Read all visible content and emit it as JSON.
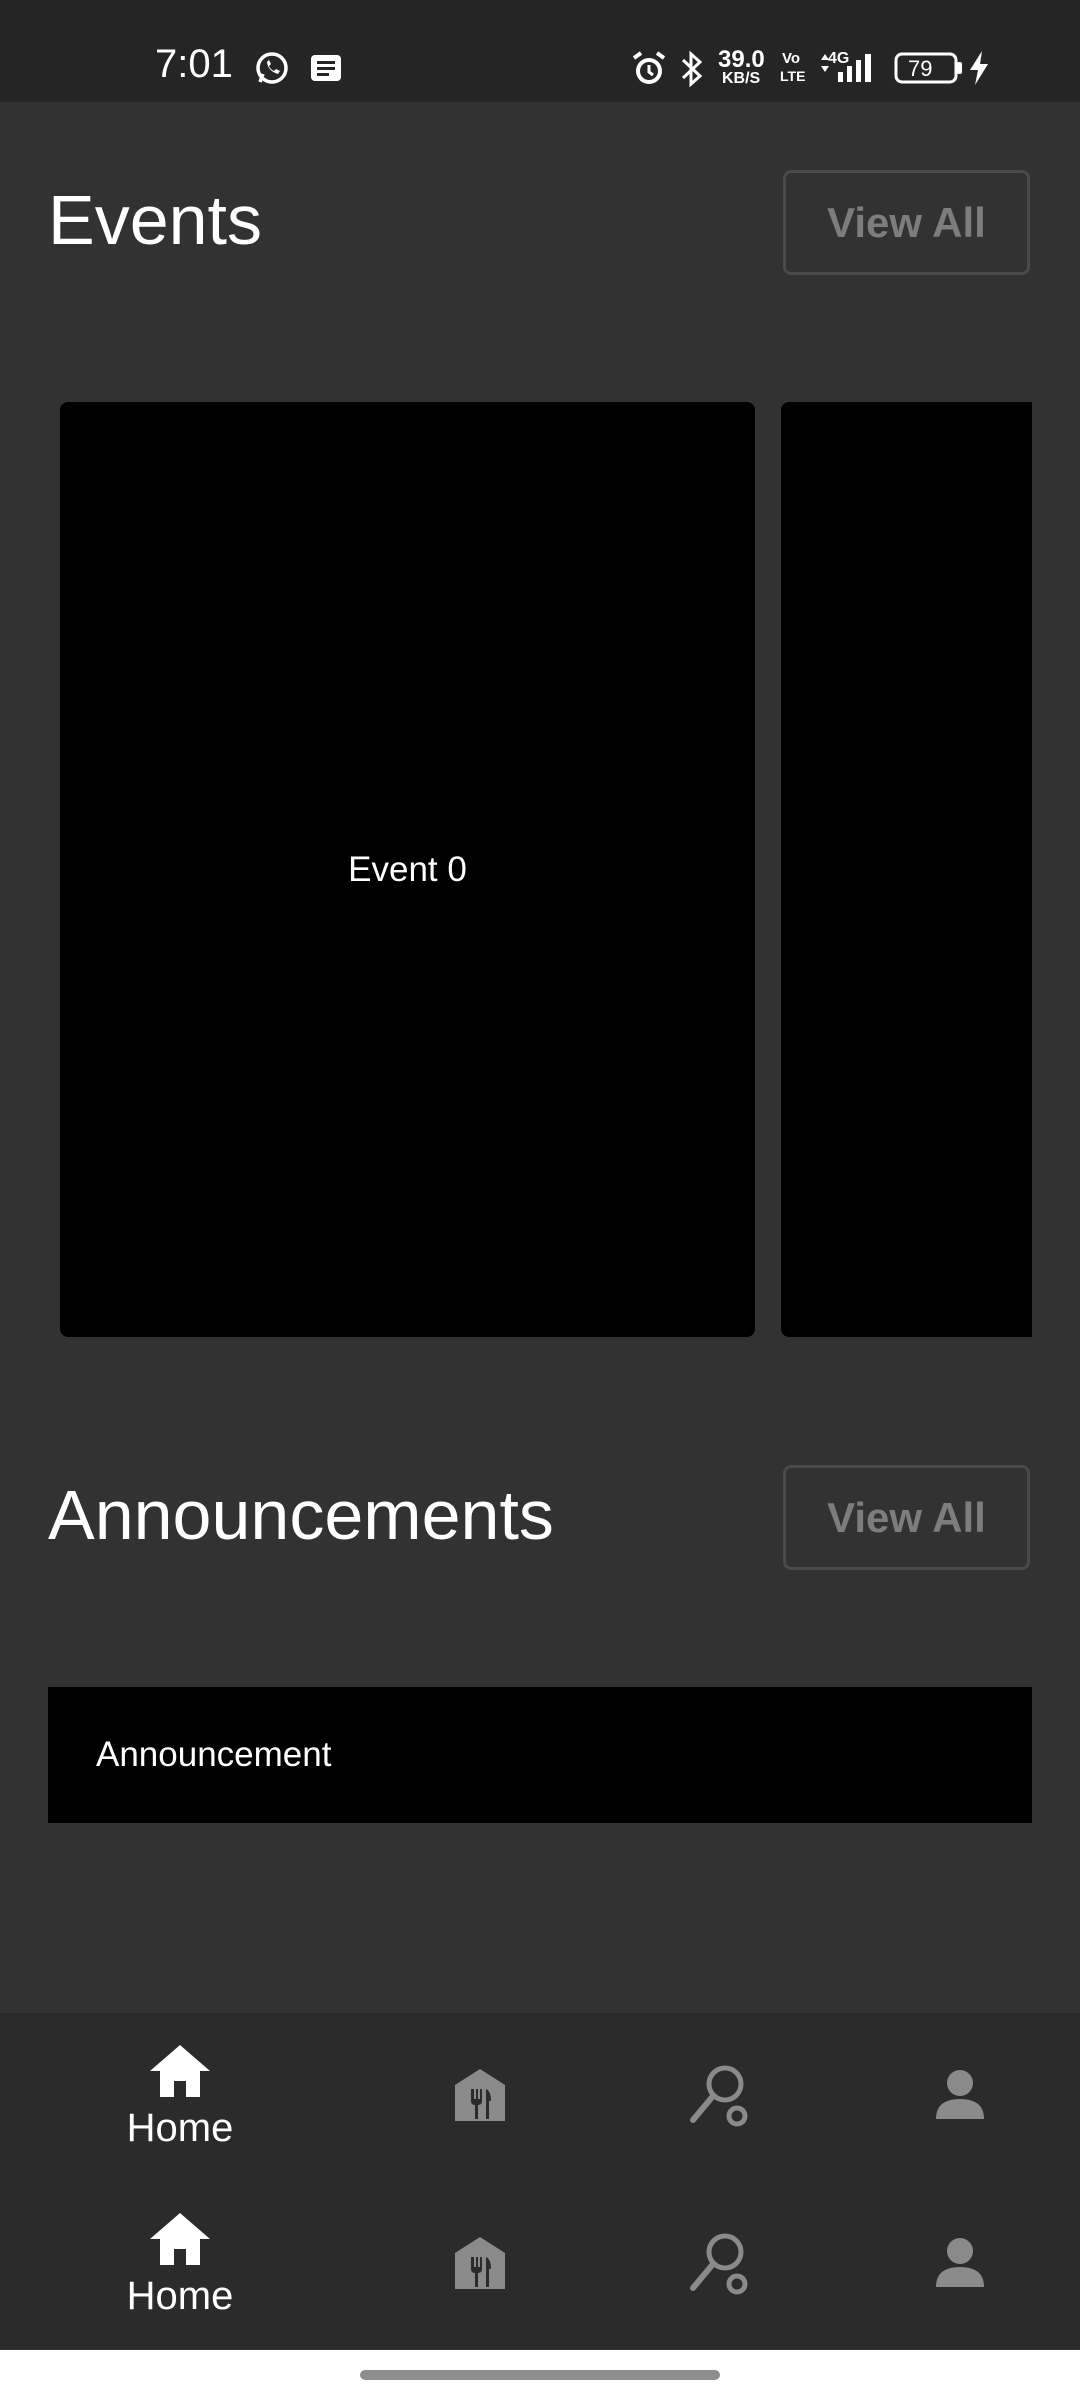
{
  "status_bar": {
    "time": "7:01",
    "net_speed_value": "39.0",
    "net_speed_unit": "KB/S",
    "volte_top": "Vo",
    "volte_bottom": "LTE",
    "network": "4G",
    "battery": "79",
    "icons": [
      "whatsapp-icon",
      "message-icon",
      "alarm-icon",
      "bluetooth-icon",
      "signal-icon",
      "battery-icon",
      "charging-icon"
    ]
  },
  "events": {
    "title": "Events",
    "view_all_label": "View All",
    "cards": [
      {
        "label": "Event 0"
      },
      {
        "label": ""
      }
    ]
  },
  "announcements": {
    "title": "Announcements",
    "view_all_label": "View All",
    "items": [
      {
        "label": "Announcement"
      }
    ]
  },
  "bottom_nav": {
    "items": [
      {
        "icon": "home-icon",
        "label": "Home",
        "active": true
      },
      {
        "icon": "restaurant-icon",
        "label": "",
        "active": false
      },
      {
        "icon": "racket-icon",
        "label": "",
        "active": false
      },
      {
        "icon": "person-icon",
        "label": "",
        "active": false
      }
    ]
  },
  "colors": {
    "background": "#323232",
    "status_bar": "#252525",
    "nav_bar": "#2b2b2b",
    "card": "#000000",
    "inactive_icon": "#8a8a8a",
    "view_all_text": "#7d7d7d"
  }
}
